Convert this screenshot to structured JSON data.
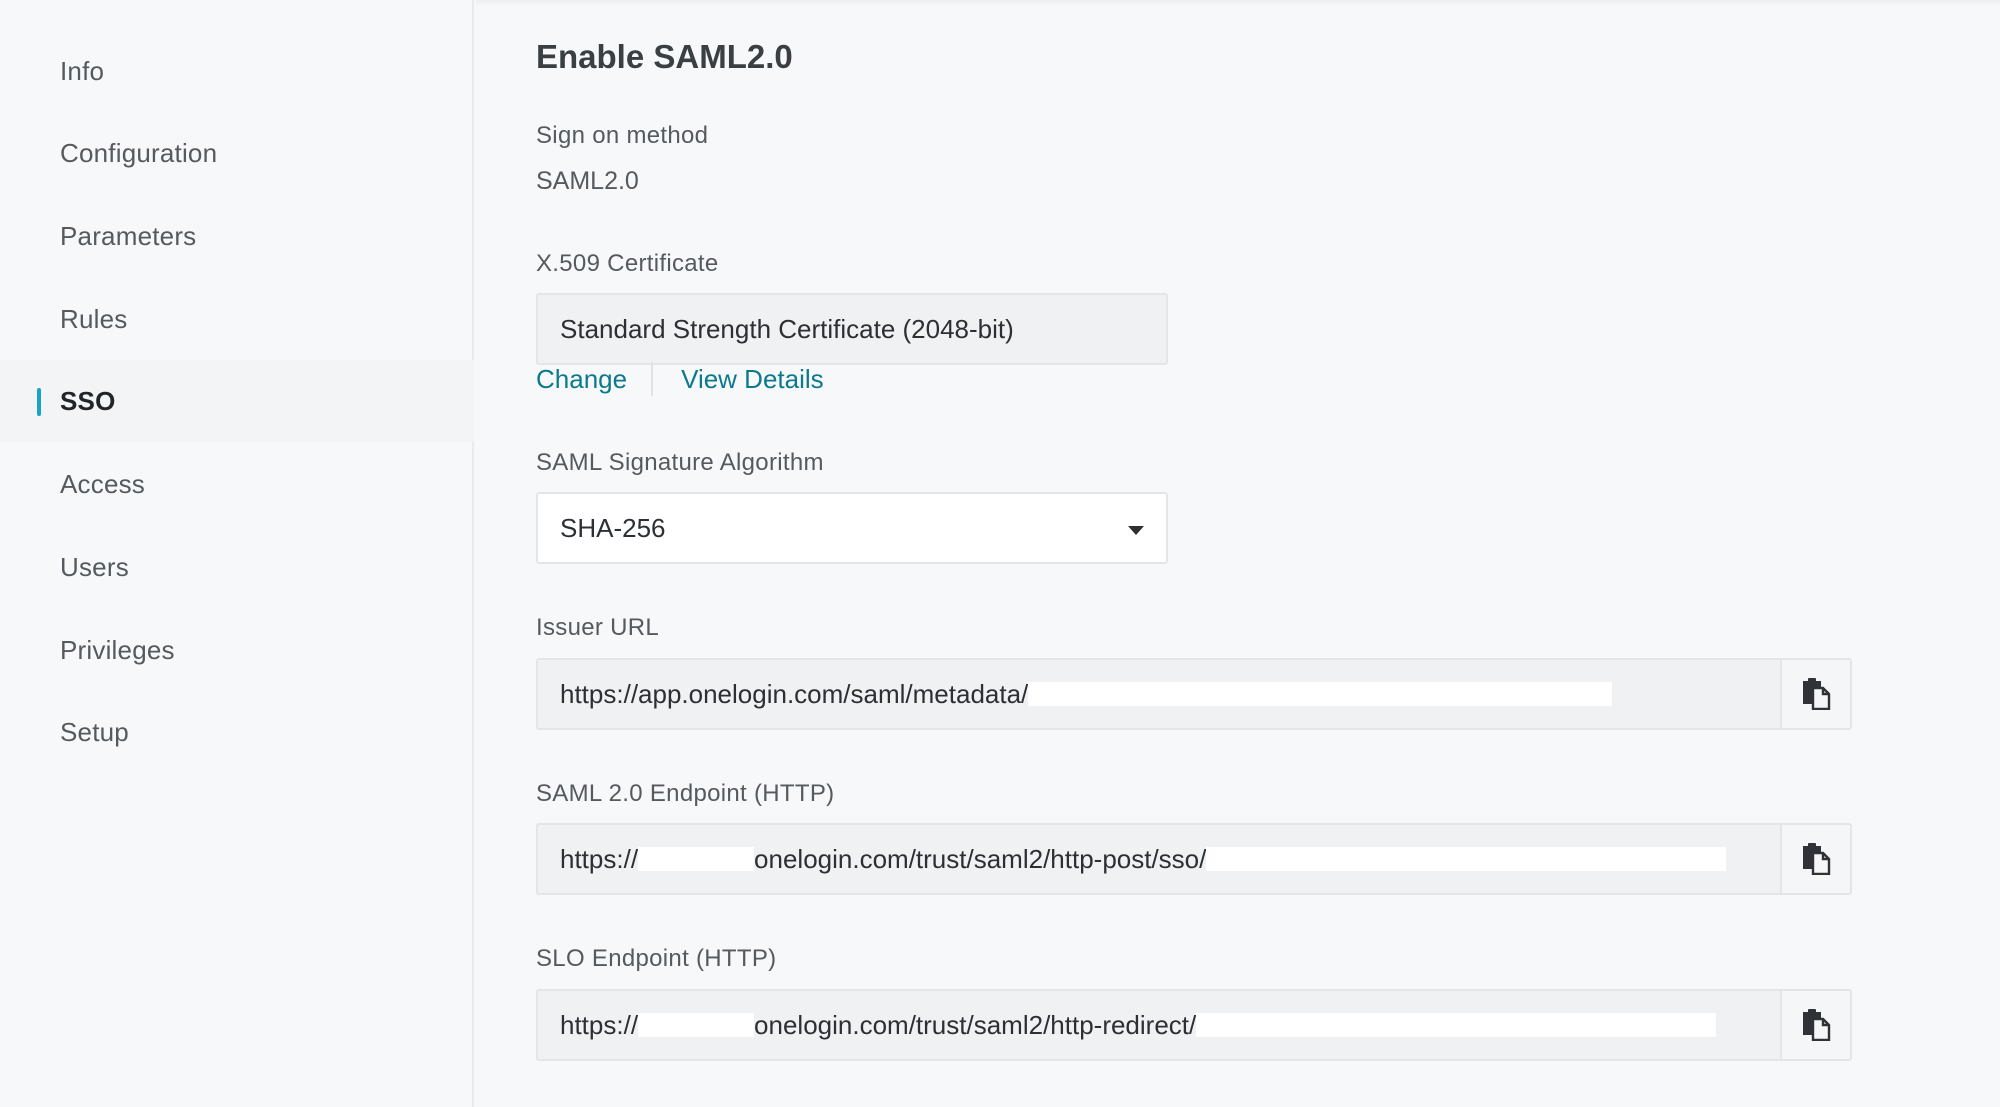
{
  "sidebar": {
    "items": [
      {
        "label": "Info",
        "active": false
      },
      {
        "label": "Configuration",
        "active": false
      },
      {
        "label": "Parameters",
        "active": false
      },
      {
        "label": "Rules",
        "active": false
      },
      {
        "label": "SSO",
        "active": true
      },
      {
        "label": "Access",
        "active": false
      },
      {
        "label": "Users",
        "active": false
      },
      {
        "label": "Privileges",
        "active": false
      },
      {
        "label": "Setup",
        "active": false
      }
    ]
  },
  "main": {
    "title": "Enable SAML2.0",
    "sign_on": {
      "label": "Sign on method",
      "value": "SAML2.0"
    },
    "certificate": {
      "label": "X.509 Certificate",
      "value": "Standard Strength Certificate (2048-bit)",
      "change_link": "Change",
      "view_details_link": "View Details"
    },
    "algorithm": {
      "label": "SAML Signature Algorithm",
      "selected": "SHA-256"
    },
    "issuer_url": {
      "label": "Issuer URL",
      "prefix": "https://app.onelogin.com/saml/metadata/"
    },
    "saml_endpoint": {
      "label": "SAML 2.0 Endpoint (HTTP)",
      "prefix": "https://",
      "middle": "onelogin.com/trust/saml2/http-post/sso/"
    },
    "slo_endpoint": {
      "label": "SLO Endpoint (HTTP)",
      "prefix": "https://",
      "middle": "onelogin.com/trust/saml2/http-redirect/"
    }
  },
  "icons": {
    "copy": "copy-icon",
    "dropdown": "chevron-down-icon"
  },
  "colors": {
    "accent": "#1aa3c8",
    "link": "#0c7a8c"
  }
}
